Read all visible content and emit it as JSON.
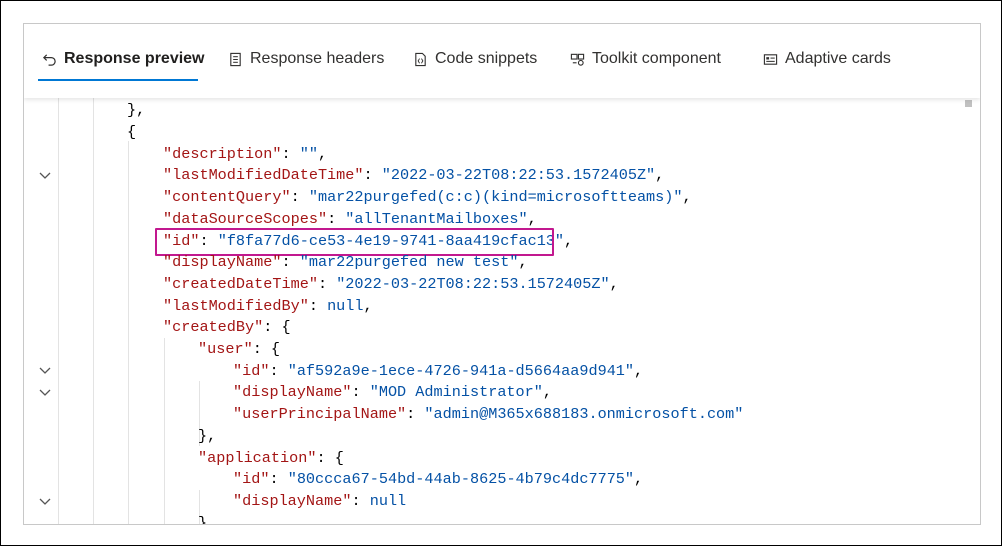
{
  "tabs": [
    {
      "label": "Response preview",
      "icon": "undo-arrow-icon",
      "active": true
    },
    {
      "label": "Response headers",
      "icon": "document-list-icon",
      "active": false
    },
    {
      "label": "Code snippets",
      "icon": "code-document-icon",
      "active": false
    },
    {
      "label": "Toolkit component",
      "icon": "toolkit-icon",
      "active": false
    },
    {
      "label": "Adaptive cards",
      "icon": "card-icon",
      "active": false
    }
  ],
  "colors": {
    "key": "#a31515",
    "string": "#0451a5",
    "accent": "#0078d4",
    "highlight": "#c2188f"
  },
  "code": {
    "l1": {
      "punct": "},"
    },
    "l2": {
      "punct": "{"
    },
    "l3": {
      "key": "\"description\"",
      "sep": ": ",
      "val": "\"\"",
      "end": ","
    },
    "l4": {
      "key": "\"lastModifiedDateTime\"",
      "sep": ": ",
      "val": "\"2022-03-22T08:22:53.1572405Z\"",
      "end": ","
    },
    "l5": {
      "key": "\"contentQuery\"",
      "sep": ": ",
      "val": "\"mar22purgefed(c:c)(kind=microsoftteams)\"",
      "end": ","
    },
    "l6": {
      "key": "\"dataSourceScopes\"",
      "sep": ": ",
      "val": "\"allTenantMailboxes\"",
      "end": ","
    },
    "l7": {
      "key": "\"id\"",
      "sep": ": ",
      "val": "\"f8fa77d6-ce53-4e19-9741-8aa419cfac13\"",
      "end": ","
    },
    "l8": {
      "key": "\"displayName\"",
      "sep": ": ",
      "val": "\"mar22purgefed new test\"",
      "end": ","
    },
    "l9": {
      "key": "\"createdDateTime\"",
      "sep": ": ",
      "val": "\"2022-03-22T08:22:53.1572405Z\"",
      "end": ","
    },
    "l10": {
      "key": "\"lastModifiedBy\"",
      "sep": ": ",
      "val": "null",
      "end": ","
    },
    "l11": {
      "key": "\"createdBy\"",
      "sep": ": ",
      "val": "{",
      "end": ""
    },
    "l12": {
      "key": "\"user\"",
      "sep": ": ",
      "val": "{",
      "end": ""
    },
    "l13": {
      "key": "\"id\"",
      "sep": ": ",
      "val": "\"af592a9e-1ece-4726-941a-d5664aa9d941\"",
      "end": ","
    },
    "l14": {
      "key": "\"displayName\"",
      "sep": ": ",
      "val": "\"MOD Administrator\"",
      "end": ","
    },
    "l15": {
      "key": "\"userPrincipalName\"",
      "sep": ": ",
      "val": "\"admin@M365x688183.onmicrosoft.com\"",
      "end": ""
    },
    "l16": {
      "punct": "},"
    },
    "l17": {
      "key": "\"application\"",
      "sep": ": ",
      "val": "{",
      "end": ""
    },
    "l18": {
      "key": "\"id\"",
      "sep": ": ",
      "val": "\"80ccca67-54bd-44ab-8625-4b79c4dc7775\"",
      "end": ","
    },
    "l19": {
      "key": "\"displayName\"",
      "sep": ": ",
      "val": "null",
      "end": ""
    },
    "l20": {
      "punct": "}"
    }
  }
}
